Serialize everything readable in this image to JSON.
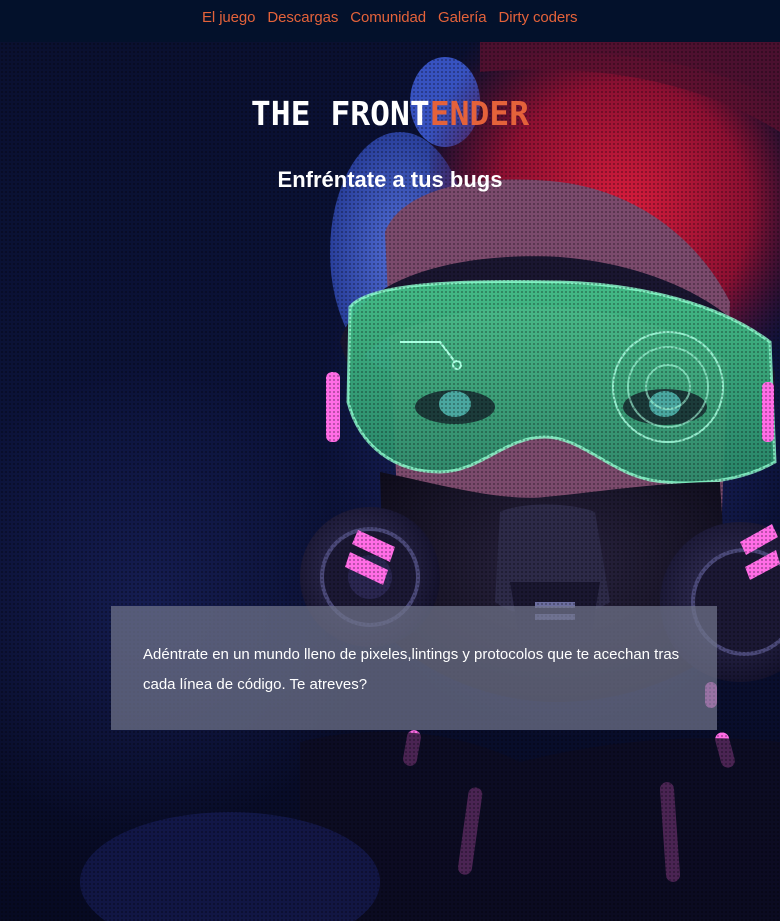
{
  "nav": {
    "items": [
      {
        "label": "El juego"
      },
      {
        "label": "Descargas"
      },
      {
        "label": "Comunidad"
      },
      {
        "label": "Galería"
      },
      {
        "label": "Dirty coders"
      }
    ]
  },
  "hero": {
    "logo_part1": "THE FRONT",
    "logo_part2": "ENDER",
    "tagline": "Enfréntate a tus bugs",
    "intro_text": "Adéntrate en un mundo lleno de pixeles,lintings y protocolos que te acechan tras cada línea de código. Te atreves?"
  },
  "colors": {
    "nav_bg": "#03112b",
    "accent": "#e4623a",
    "logo_white": "#ffffff",
    "card_bg": "#70748a"
  },
  "icons": {
    "hero_image": "cyberpunk-gasmask-character-illustration"
  }
}
